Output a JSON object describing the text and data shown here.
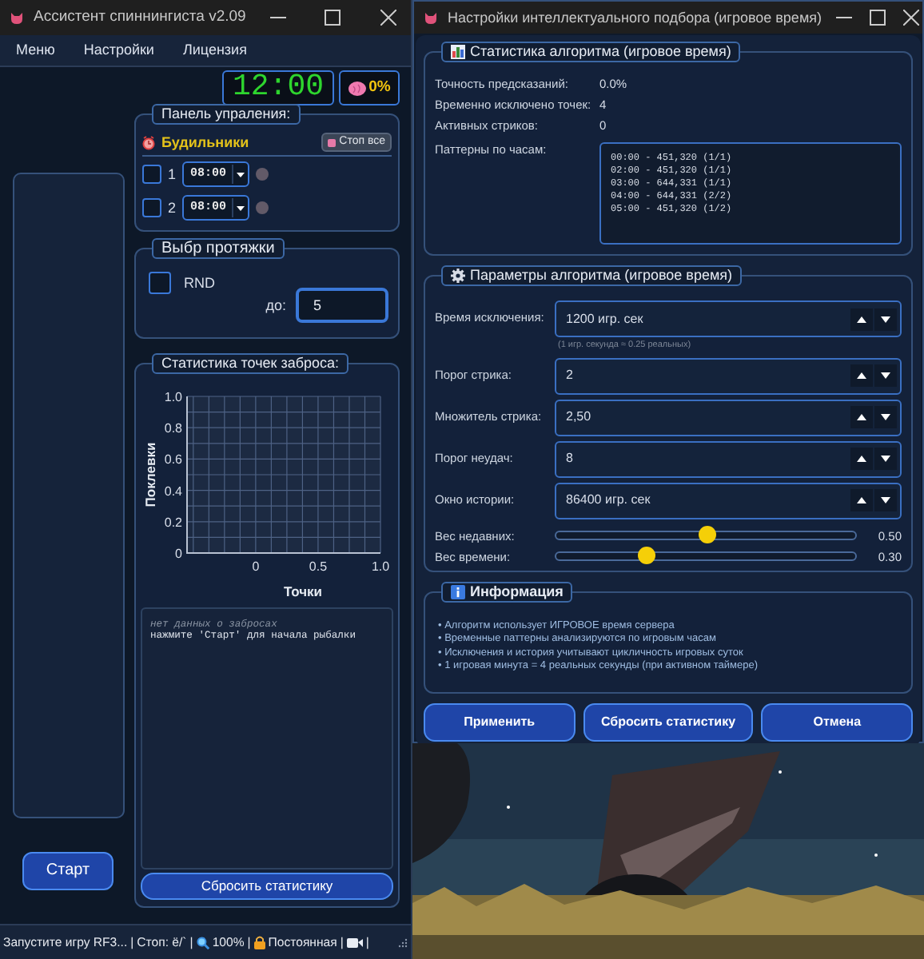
{
  "left_window": {
    "title": "Ассистент спиннингиста v2.09",
    "menu": [
      {
        "label": "Меню"
      },
      {
        "label": "Настройки"
      },
      {
        "label": "Лицензия"
      }
    ],
    "clock": "12:00",
    "load": "0%",
    "control_panel": {
      "title": "Панель упраления:",
      "alarms_label": "Будильники",
      "stop_all": "Стоп все",
      "alarms": [
        {
          "number": "1",
          "time": "08:00",
          "checked": false
        },
        {
          "number": "2",
          "time": "08:00",
          "checked": false
        }
      ]
    },
    "cast_panel": {
      "title": "Выбр протяжки",
      "rnd": {
        "label": "RND",
        "checked": false
      },
      "to_label": "до:",
      "to_value": "5"
    },
    "stats_panel": {
      "title": "Статистика точек заброса:",
      "chart_data": {
        "type": "scatter",
        "grid": true,
        "xlabel": "Точки",
        "ylabel": "Поклевки",
        "xlim": [
          -0.55,
          1.0
        ],
        "ylim": [
          0,
          1
        ],
        "xticks": [
          0,
          0.5,
          {
            "value": 1,
            "label": "1.0"
          }
        ],
        "yticks": [
          0,
          0.2,
          0.4,
          0.6,
          0.8,
          {
            "value": 1,
            "label": "1.0"
          }
        ]
      },
      "log": [
        {
          "kind": "hint",
          "text": "нет данных о забросах"
        },
        {
          "kind": "line",
          "text": "нажмите 'Старт' для начала рыбалки"
        }
      ],
      "reset": "Сбросить статистику"
    },
    "start": "Старт",
    "status_bar": {
      "message": "Запустите игру RF3...",
      "hotkey": "Стоп: ё/`",
      "zoom": "100%",
      "mode": "Постоянная",
      "separators": [
        "|",
        "|",
        "|",
        "|",
        "|"
      ]
    }
  },
  "settings_window": {
    "title": "Настройки интеллектуального подбора (игровое время)",
    "stats": {
      "title": "Статистика алгоритма (игровое время)",
      "rows": [
        {
          "label": "Точность предсказаний:",
          "value": "0.0%"
        },
        {
          "label": "Временно исключено точек:",
          "value": "4"
        },
        {
          "label": "Активных стриков:",
          "value": "0"
        }
      ],
      "patterns_label": "Паттерны по часам:",
      "patterns": [
        "00:00 - 451,320 (1/1)",
        "02:00 - 451,320 (1/1)",
        "03:00 - 644,331 (1/1)",
        "04:00 - 644,331 (2/2)",
        "05:00 - 451,320 (1/2)"
      ]
    },
    "params": {
      "title": "Параметры алгоритма (игровое время)",
      "fields": [
        {
          "label": "Время исключения:",
          "value": "1200 игр. сек",
          "hint": "(1 игр. секунда ≈ 0.25 реальных)"
        },
        {
          "label": "Порог стрика:",
          "value": "2"
        },
        {
          "label": "Множитель стрика:",
          "value": "2,50"
        },
        {
          "label": "Порог неудач:",
          "value": "8"
        },
        {
          "label": "Окно истории:",
          "value": "86400 игр. сек"
        }
      ],
      "sliders": [
        {
          "label": "Вес недавних:",
          "level": 0.5,
          "reading": "0.50"
        },
        {
          "label": "Вес времени:",
          "level": 0.3,
          "reading": "0.30"
        }
      ]
    },
    "info": {
      "title": "Информация",
      "lines": [
        "• Алгоритм использует ИГРОВОЕ время сервера",
        "• Временные паттерны анализируются по игровым часам",
        "• Исключения и история учитывают цикличность игровых суток",
        "• 1 игровая минута = 4 реальных секунды (при активном таймере)"
      ]
    },
    "buttons": [
      "Применить",
      "Сбросить статистику",
      "Отмена"
    ]
  }
}
